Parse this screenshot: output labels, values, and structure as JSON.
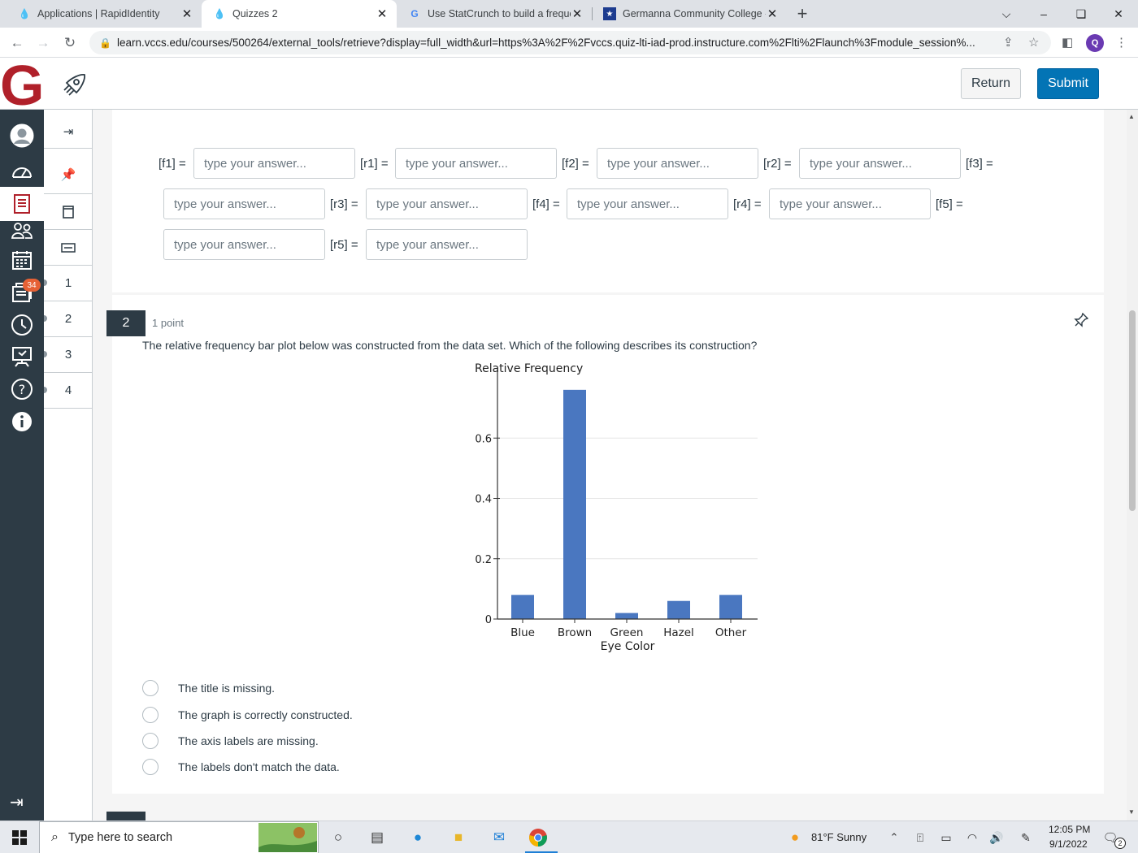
{
  "browser": {
    "tabs": [
      {
        "title": "Applications | RapidIdentity",
        "active": false
      },
      {
        "title": "Quizzes 2",
        "active": true
      },
      {
        "title": "Use StatCrunch to build a frequen",
        "active": false
      },
      {
        "title": "Germanna Community College -",
        "active": false
      }
    ],
    "url": "learn.vccs.edu/courses/500264/external_tools/retrieve?display=full_width&url=https%3A%2F%2Fvccs.quiz-lti-iad-prod.instructure.com%2Flti%2Flaunch%3Fmodule_session%...",
    "profile_initial": "Q"
  },
  "header": {
    "logo_letter": "G",
    "return_label": "Return",
    "submit_label": "Submit"
  },
  "global_nav": {
    "inbox_badge": "34"
  },
  "quiz_nav": {
    "items": [
      "1",
      "2",
      "3",
      "4"
    ]
  },
  "question1": {
    "placeholder": "type your answer...",
    "labels": [
      "[f1] =",
      "[r1] =",
      "[f2] =",
      "[r2] =",
      "[f3] =",
      "[r3] =",
      "[f4] =",
      "[r4] =",
      "[f5] =",
      "[r5] ="
    ]
  },
  "question2": {
    "number": "2",
    "points": "1 point",
    "text": "The relative frequency bar plot below was constructed from the data set. Which of the following describes its construction?",
    "options": [
      "The title is missing.",
      "The graph is correctly constructed.",
      "The axis labels are missing.",
      "The labels don't match the data."
    ]
  },
  "chart_data": {
    "type": "bar",
    "title": "",
    "ylabel": "Relative Frequency",
    "xlabel": "Eye Color",
    "categories": [
      "Blue",
      "Brown",
      "Green",
      "Hazel",
      "Other"
    ],
    "values": [
      0.08,
      0.76,
      0.02,
      0.06,
      0.08
    ],
    "ylim": [
      0,
      0.8
    ],
    "yticks": [
      "0",
      "0.2",
      "0.4",
      "0.6"
    ],
    "bar_color": "#4a77c0",
    "grid": true
  },
  "taskbar": {
    "search_placeholder": "Type here to search",
    "weather": "81°F  Sunny",
    "time": "12:05 PM",
    "date": "9/1/2022",
    "notification_count": "2"
  }
}
